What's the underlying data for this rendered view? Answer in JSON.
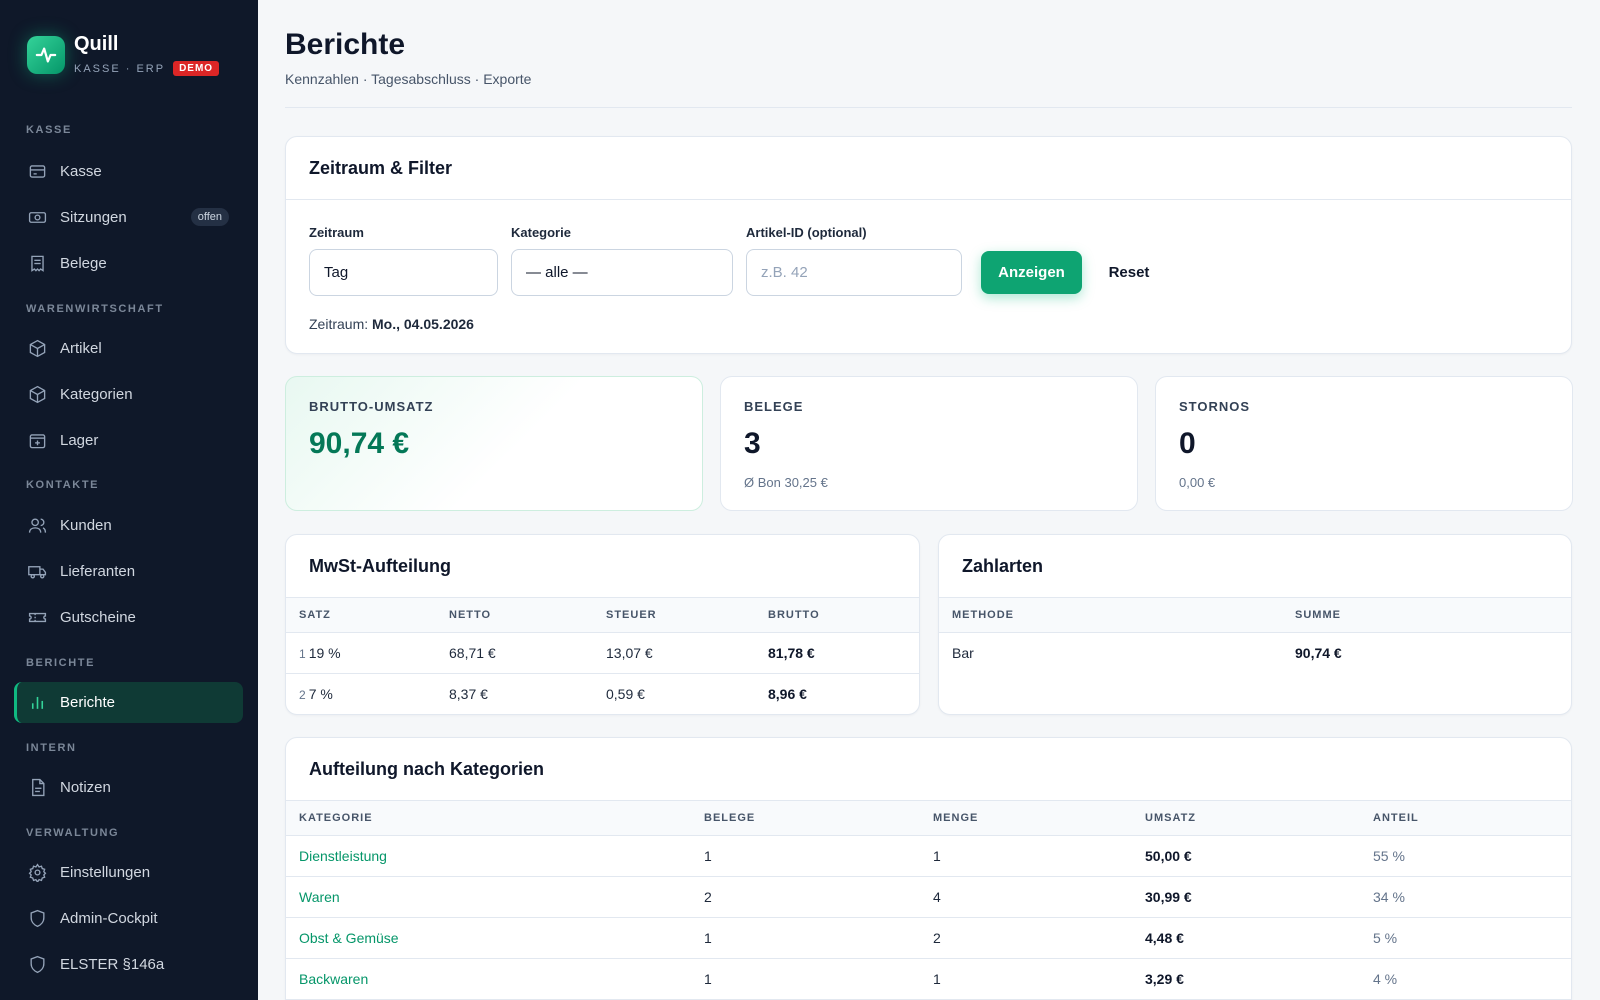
{
  "brand": {
    "name": "Quill",
    "tagline": "KASSE · ERP",
    "badge": "DEMO"
  },
  "sidebar": {
    "sections": [
      {
        "label": "KASSE"
      },
      {
        "label": "WARENWIRTSCHAFT"
      },
      {
        "label": "KONTAKTE"
      },
      {
        "label": "BERICHTE"
      },
      {
        "label": "INTERN"
      },
      {
        "label": "VERWALTUNG"
      }
    ],
    "items": [
      {
        "label": "Kasse",
        "icon": "register-icon"
      },
      {
        "label": "Sitzungen",
        "icon": "cash-icon",
        "badge": "offen"
      },
      {
        "label": "Belege",
        "icon": "receipt-icon"
      },
      {
        "label": "Artikel",
        "icon": "box-icon"
      },
      {
        "label": "Kategorien",
        "icon": "box-icon"
      },
      {
        "label": "Lager",
        "icon": "warehouse-icon"
      },
      {
        "label": "Kunden",
        "icon": "users-icon"
      },
      {
        "label": "Lieferanten",
        "icon": "truck-icon"
      },
      {
        "label": "Gutscheine",
        "icon": "ticket-icon"
      },
      {
        "label": "Berichte",
        "icon": "bar-chart-icon",
        "active": true
      },
      {
        "label": "Notizen",
        "icon": "note-icon"
      },
      {
        "label": "Einstellungen",
        "icon": "gear-icon"
      },
      {
        "label": "Admin-Cockpit",
        "icon": "shield-icon"
      },
      {
        "label": "ELSTER §146a",
        "icon": "shield-icon"
      }
    ]
  },
  "header": {
    "title": "Berichte",
    "subtitle": "Kennzahlen · Tagesabschluss · Exporte"
  },
  "filter": {
    "title": "Zeitraum & Filter",
    "period_label": "Zeitraum",
    "period_value": "Tag",
    "category_label": "Kategorie",
    "category_value": "— alle —",
    "article_label": "Artikel-ID (optional)",
    "article_placeholder": "z.B. 42",
    "show_button": "Anzeigen",
    "reset_button": "Reset",
    "range_prefix": "Zeitraum:",
    "range_value": "Mo., 04.05.2026"
  },
  "kpis": {
    "revenue": {
      "label": "BRUTTO-UMSATZ",
      "value": "90,74 €"
    },
    "receipts": {
      "label": "BELEGE",
      "value": "3",
      "sub": "Ø Bon 30,25 €"
    },
    "cancellations": {
      "label": "STORNOS",
      "value": "0",
      "sub": "0,00 €"
    }
  },
  "vat": {
    "title": "MwSt-Aufteilung",
    "headers": [
      "SATZ",
      "NETTO",
      "STEUER",
      "BRUTTO"
    ],
    "rows": [
      {
        "num": "1",
        "rate": "19 %",
        "net": "68,71 €",
        "tax": "13,07 €",
        "gross": "81,78 €"
      },
      {
        "num": "2",
        "rate": "7 %",
        "net": "8,37 €",
        "tax": "0,59 €",
        "gross": "8,96 €"
      }
    ]
  },
  "payments": {
    "title": "Zahlarten",
    "headers": [
      "METHODE",
      "SUMME"
    ],
    "rows": [
      {
        "method": "Bar",
        "sum": "90,74 €"
      }
    ]
  },
  "categories": {
    "title": "Aufteilung nach Kategorien",
    "headers": [
      "KATEGORIE",
      "BELEGE",
      "MENGE",
      "UMSATZ",
      "ANTEIL"
    ],
    "rows": [
      {
        "name": "Dienstleistung",
        "receipts": "1",
        "qty": "1",
        "revenue": "50,00 €",
        "share": "55 %"
      },
      {
        "name": "Waren",
        "receipts": "2",
        "qty": "4",
        "revenue": "30,99 €",
        "share": "34 %"
      },
      {
        "name": "Obst & Gemüse",
        "receipts": "1",
        "qty": "2",
        "revenue": "4,48 €",
        "share": "5 %"
      },
      {
        "name": "Backwaren",
        "receipts": "1",
        "qty": "1",
        "revenue": "3,29 €",
        "share": "4 %"
      }
    ]
  },
  "colors": {
    "accent": "#10b981",
    "sidebar": "#0f1829",
    "badge": "#dc2626",
    "link": "#059669"
  }
}
